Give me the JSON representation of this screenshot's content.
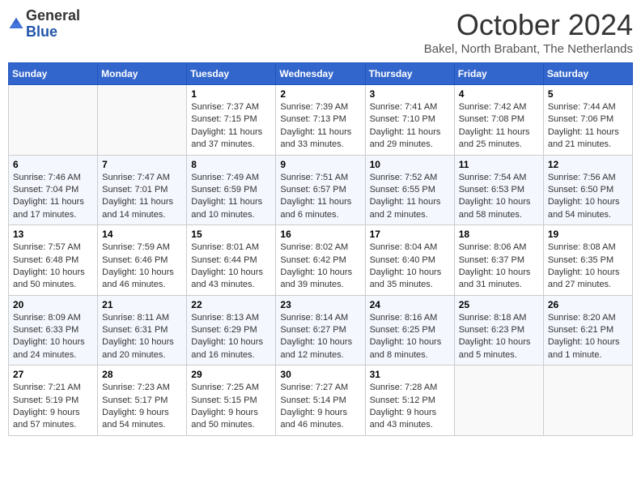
{
  "header": {
    "logo_general": "General",
    "logo_blue": "Blue",
    "month_title": "October 2024",
    "subtitle": "Bakel, North Brabant, The Netherlands"
  },
  "days_of_week": [
    "Sunday",
    "Monday",
    "Tuesday",
    "Wednesday",
    "Thursday",
    "Friday",
    "Saturday"
  ],
  "weeks": [
    [
      {
        "day": "",
        "info": ""
      },
      {
        "day": "",
        "info": ""
      },
      {
        "day": "1",
        "info": "Sunrise: 7:37 AM\nSunset: 7:15 PM\nDaylight: 11 hours and 37 minutes."
      },
      {
        "day": "2",
        "info": "Sunrise: 7:39 AM\nSunset: 7:13 PM\nDaylight: 11 hours and 33 minutes."
      },
      {
        "day": "3",
        "info": "Sunrise: 7:41 AM\nSunset: 7:10 PM\nDaylight: 11 hours and 29 minutes."
      },
      {
        "day": "4",
        "info": "Sunrise: 7:42 AM\nSunset: 7:08 PM\nDaylight: 11 hours and 25 minutes."
      },
      {
        "day": "5",
        "info": "Sunrise: 7:44 AM\nSunset: 7:06 PM\nDaylight: 11 hours and 21 minutes."
      }
    ],
    [
      {
        "day": "6",
        "info": "Sunrise: 7:46 AM\nSunset: 7:04 PM\nDaylight: 11 hours and 17 minutes."
      },
      {
        "day": "7",
        "info": "Sunrise: 7:47 AM\nSunset: 7:01 PM\nDaylight: 11 hours and 14 minutes."
      },
      {
        "day": "8",
        "info": "Sunrise: 7:49 AM\nSunset: 6:59 PM\nDaylight: 11 hours and 10 minutes."
      },
      {
        "day": "9",
        "info": "Sunrise: 7:51 AM\nSunset: 6:57 PM\nDaylight: 11 hours and 6 minutes."
      },
      {
        "day": "10",
        "info": "Sunrise: 7:52 AM\nSunset: 6:55 PM\nDaylight: 11 hours and 2 minutes."
      },
      {
        "day": "11",
        "info": "Sunrise: 7:54 AM\nSunset: 6:53 PM\nDaylight: 10 hours and 58 minutes."
      },
      {
        "day": "12",
        "info": "Sunrise: 7:56 AM\nSunset: 6:50 PM\nDaylight: 10 hours and 54 minutes."
      }
    ],
    [
      {
        "day": "13",
        "info": "Sunrise: 7:57 AM\nSunset: 6:48 PM\nDaylight: 10 hours and 50 minutes."
      },
      {
        "day": "14",
        "info": "Sunrise: 7:59 AM\nSunset: 6:46 PM\nDaylight: 10 hours and 46 minutes."
      },
      {
        "day": "15",
        "info": "Sunrise: 8:01 AM\nSunset: 6:44 PM\nDaylight: 10 hours and 43 minutes."
      },
      {
        "day": "16",
        "info": "Sunrise: 8:02 AM\nSunset: 6:42 PM\nDaylight: 10 hours and 39 minutes."
      },
      {
        "day": "17",
        "info": "Sunrise: 8:04 AM\nSunset: 6:40 PM\nDaylight: 10 hours and 35 minutes."
      },
      {
        "day": "18",
        "info": "Sunrise: 8:06 AM\nSunset: 6:37 PM\nDaylight: 10 hours and 31 minutes."
      },
      {
        "day": "19",
        "info": "Sunrise: 8:08 AM\nSunset: 6:35 PM\nDaylight: 10 hours and 27 minutes."
      }
    ],
    [
      {
        "day": "20",
        "info": "Sunrise: 8:09 AM\nSunset: 6:33 PM\nDaylight: 10 hours and 24 minutes."
      },
      {
        "day": "21",
        "info": "Sunrise: 8:11 AM\nSunset: 6:31 PM\nDaylight: 10 hours and 20 minutes."
      },
      {
        "day": "22",
        "info": "Sunrise: 8:13 AM\nSunset: 6:29 PM\nDaylight: 10 hours and 16 minutes."
      },
      {
        "day": "23",
        "info": "Sunrise: 8:14 AM\nSunset: 6:27 PM\nDaylight: 10 hours and 12 minutes."
      },
      {
        "day": "24",
        "info": "Sunrise: 8:16 AM\nSunset: 6:25 PM\nDaylight: 10 hours and 8 minutes."
      },
      {
        "day": "25",
        "info": "Sunrise: 8:18 AM\nSunset: 6:23 PM\nDaylight: 10 hours and 5 minutes."
      },
      {
        "day": "26",
        "info": "Sunrise: 8:20 AM\nSunset: 6:21 PM\nDaylight: 10 hours and 1 minute."
      }
    ],
    [
      {
        "day": "27",
        "info": "Sunrise: 7:21 AM\nSunset: 5:19 PM\nDaylight: 9 hours and 57 minutes."
      },
      {
        "day": "28",
        "info": "Sunrise: 7:23 AM\nSunset: 5:17 PM\nDaylight: 9 hours and 54 minutes."
      },
      {
        "day": "29",
        "info": "Sunrise: 7:25 AM\nSunset: 5:15 PM\nDaylight: 9 hours and 50 minutes."
      },
      {
        "day": "30",
        "info": "Sunrise: 7:27 AM\nSunset: 5:14 PM\nDaylight: 9 hours and 46 minutes."
      },
      {
        "day": "31",
        "info": "Sunrise: 7:28 AM\nSunset: 5:12 PM\nDaylight: 9 hours and 43 minutes."
      },
      {
        "day": "",
        "info": ""
      },
      {
        "day": "",
        "info": ""
      }
    ]
  ]
}
